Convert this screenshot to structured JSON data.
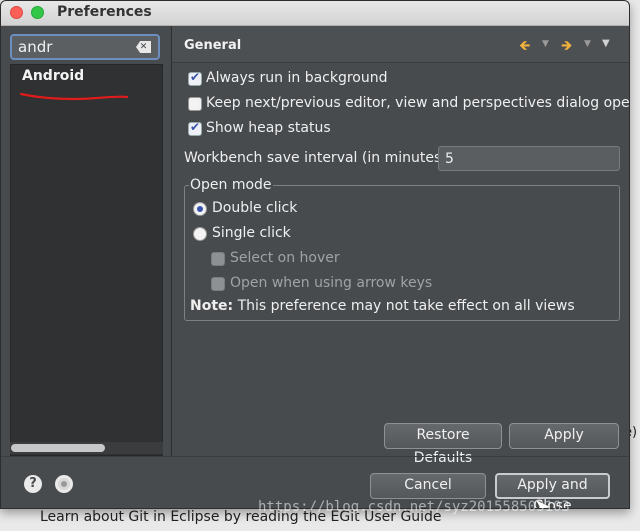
{
  "window": {
    "title": "Preferences"
  },
  "filter": {
    "value": "andr",
    "clear_icon": "clear-search-icon"
  },
  "tree": {
    "items": [
      {
        "label": "Android"
      }
    ]
  },
  "page": {
    "title": "General",
    "nav": {
      "back_icon": "arrow-left-icon",
      "forward_icon": "arrow-right-icon",
      "menu_icon": "view-menu-icon"
    }
  },
  "options": {
    "always_run_background": {
      "label": "Always run in background",
      "checked": true
    },
    "keep_next_prev": {
      "label": "Keep next/previous editor, view and perspectives dialog open",
      "checked": false
    },
    "show_heap": {
      "label": "Show heap status",
      "checked": true
    }
  },
  "interval": {
    "label": "Workbench save interval (in minutes):",
    "value": "5"
  },
  "open_mode": {
    "title": "Open mode",
    "double_click": {
      "label": "Double click",
      "selected": true
    },
    "single_click": {
      "label": "Single click",
      "selected": false
    },
    "select_on_hover": {
      "label": "Select on hover",
      "enabled": false
    },
    "open_arrow_keys": {
      "label": "Open when using arrow keys",
      "enabled": false
    },
    "note_bold": "Note:",
    "note_text": "This preference may not take effect on all views"
  },
  "buttons": {
    "restore_defaults": "Restore Defaults",
    "apply": "Apply",
    "cancel": "Cancel",
    "apply_close": "Apply and Close"
  },
  "footer": {
    "help_icon": "help-icon",
    "oomph_icon": "record-preferences-icon"
  },
  "background": {
    "bottom_text": "Learn about Git in Eclipse by reading the EGit User Guide",
    "right_text": "e)"
  },
  "watermark": "https://blog.csdn.net/syz201558503103"
}
